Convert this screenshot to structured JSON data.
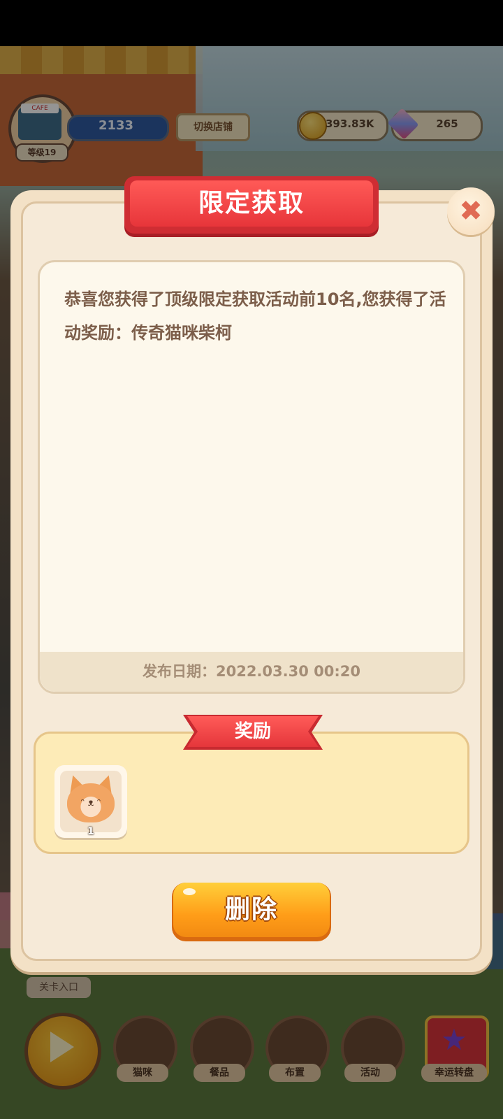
{
  "hud": {
    "level": "等级19",
    "xp_value": "2133",
    "switch_store_label": "切换店铺",
    "coins": "393.83K",
    "gems": "265",
    "shop_sign": "CAFE"
  },
  "dialog": {
    "title": "限定获取",
    "message": "恭喜您获得了顶级限定获取活动前10名,您获得了活动奖励：传奇猫咪柴柯",
    "publish_date": "发布日期：2022.03.30 00:20",
    "reward_header": "奖励",
    "reward_items": [
      {
        "icon": "orange-cat-icon",
        "count": "1"
      }
    ],
    "delete_label": "删除",
    "close_icon": "close-icon"
  },
  "bottom_nav": {
    "level_entry": "关卡入口",
    "items": [
      {
        "label": "猫咪",
        "icon": "paw-icon"
      },
      {
        "label": "餐品",
        "icon": "donut-icon"
      },
      {
        "label": "布置",
        "icon": "rocking-horse-icon"
      },
      {
        "label": "活动",
        "icon": "pinwheel-icon"
      },
      {
        "label": "幸运转盘",
        "icon": "star-icon"
      }
    ]
  }
}
